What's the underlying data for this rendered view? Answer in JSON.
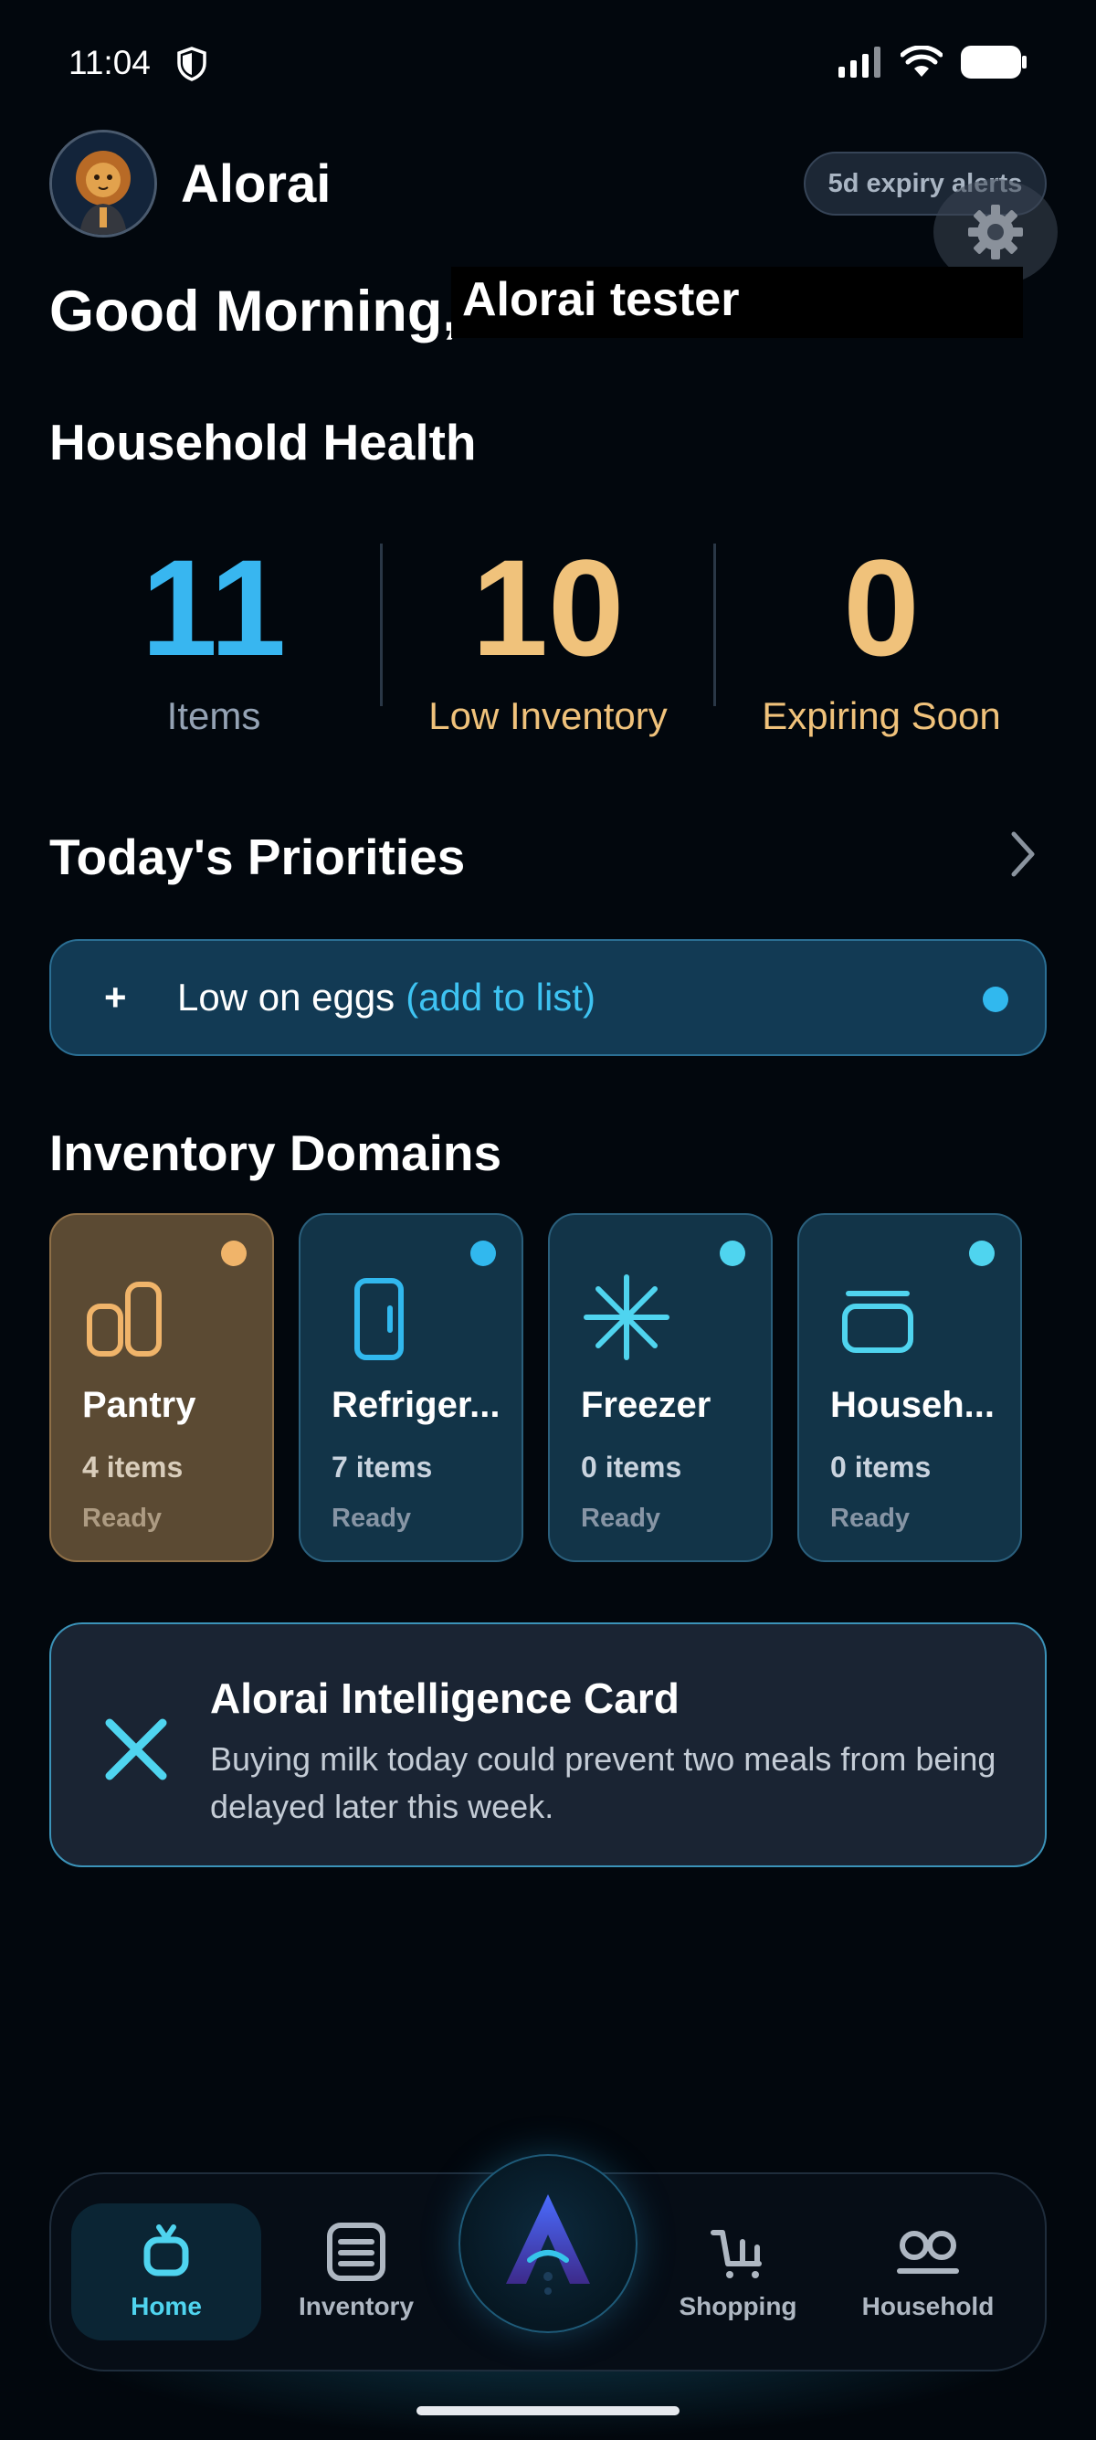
{
  "status_bar": {
    "time": "11:04"
  },
  "header": {
    "app_name": "Alorai",
    "expiry_alert_label": "5d expiry alerts"
  },
  "greeting": {
    "prefix": "Good Morning, ",
    "name": "Alorai tester"
  },
  "household_health": {
    "title": "Household Health",
    "stats": [
      {
        "value": "11",
        "label": "Items",
        "value_color": "#38b6f0",
        "label_color": "#94a2b4"
      },
      {
        "value": "10",
        "label": "Low Inventory",
        "value_color": "#f0c27b",
        "label_color": "#f0c27b"
      },
      {
        "value": "0",
        "label": "Expiring Soon",
        "value_color": "#f0c27b",
        "label_color": "#f0c27b"
      }
    ]
  },
  "priorities": {
    "title": "Today's Priorities",
    "items": [
      {
        "icon": "+",
        "text": "Low on eggs",
        "action": "(add to list)"
      }
    ]
  },
  "inventory_domains": {
    "title": "Inventory Domains",
    "items": [
      {
        "name": "Pantry",
        "count": "4 items",
        "status": "Ready",
        "icon": "pantry-icon",
        "dot_color": "#f0b46a"
      },
      {
        "name": "Refriger...",
        "count": "7 items",
        "status": "Ready",
        "icon": "fridge-icon",
        "dot_color": "#31b8ee"
      },
      {
        "name": "Freezer",
        "count": "0 items",
        "status": "Ready",
        "icon": "snowflake-icon",
        "dot_color": "#4fd4ef"
      },
      {
        "name": "Househ...",
        "count": "0 items",
        "status": "Ready",
        "icon": "household-box-icon",
        "dot_color": "#4fd4ef"
      }
    ]
  },
  "intelligence_card": {
    "title": "Alorai Intelligence Card",
    "body": "Buying milk today could prevent two meals from being delayed later this week."
  },
  "bottom_nav": {
    "items": [
      {
        "label": "Home",
        "icon": "home-icon",
        "active": true
      },
      {
        "label": "Inventory",
        "icon": "inventory-list-icon",
        "active": false
      },
      {
        "label": "Shopping",
        "icon": "cart-icon",
        "active": false
      },
      {
        "label": "Household",
        "icon": "people-icon",
        "active": false
      }
    ],
    "center_icon": "alorai-logo-icon"
  },
  "colors": {
    "accent_blue": "#38b6f0",
    "accent_cyan": "#4fd4ef",
    "accent_gold": "#f0c27b",
    "background": "#02070d"
  }
}
